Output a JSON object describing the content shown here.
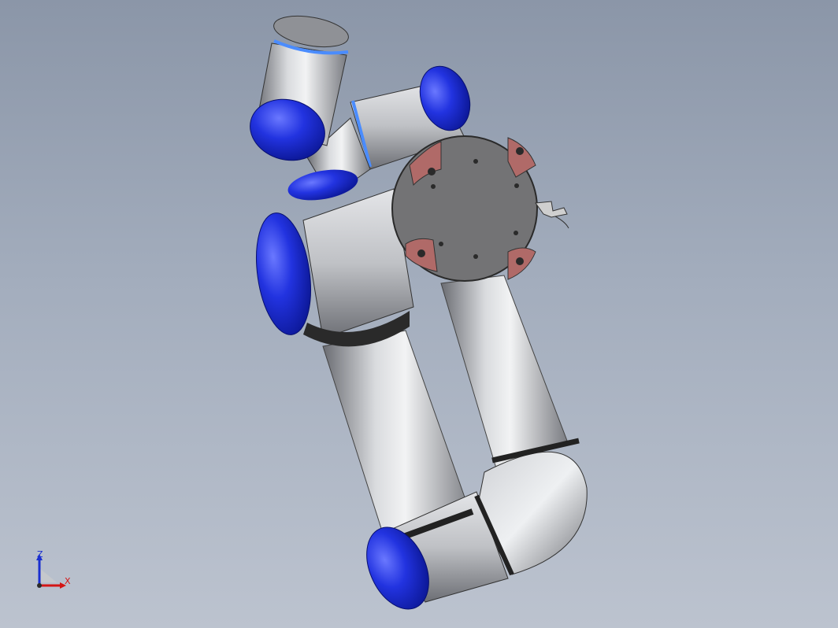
{
  "triad": {
    "z_label": "Z",
    "x_label": "X"
  },
  "colors": {
    "background_top": "#8b96a8",
    "background_bottom": "#bcc3cf",
    "link_metal": "#b9bcc2",
    "cap_blue": "#1f2fd8",
    "flange_gray": "#6e6e70",
    "pad_red": "#b06a68",
    "axis_z": "#1a2fd0",
    "axis_x": "#d41515"
  },
  "icons": [
    "coordinate-triad-icon"
  ]
}
